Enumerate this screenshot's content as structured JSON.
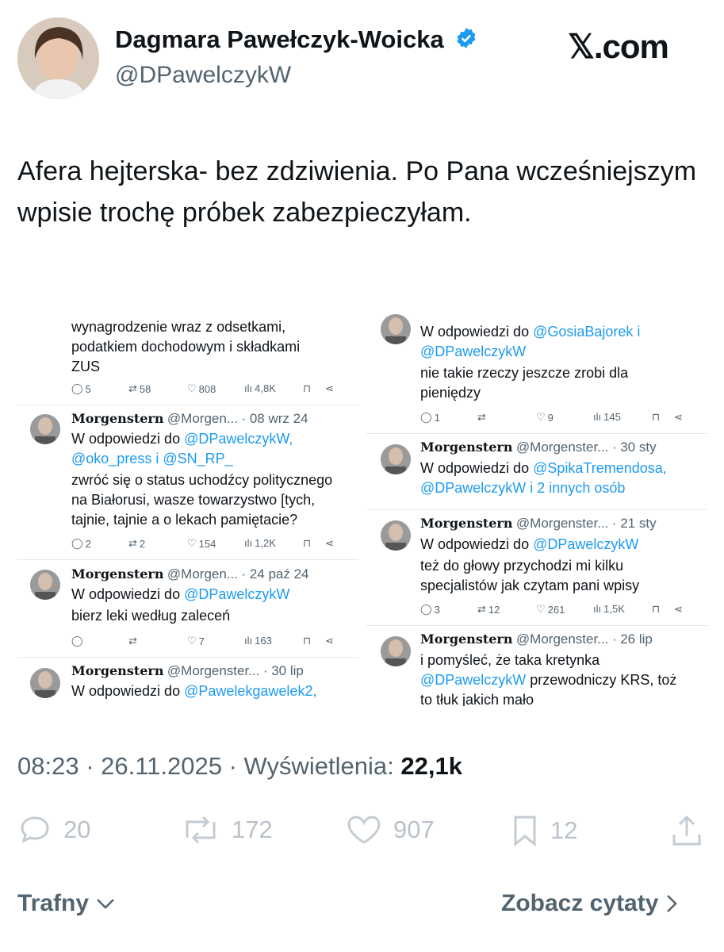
{
  "author": {
    "name": "Dagmara Pawełczyk-Woicka",
    "handle": "@DPawelczykW"
  },
  "brand": "𝕏.com",
  "tweet_text": "Afera hejterska- bez zdziwienia. Po Pana wcześniejszym wpisie trochę próbek zabezpieczyłam.",
  "screenshot": {
    "left_column": [
      {
        "lines": [
          "wynagrodzenie wraz z odsetkami,",
          "podatkiem dochodowym i składkami",
          "ZUS"
        ],
        "stats": {
          "replies": "5",
          "reposts": "58",
          "likes": "808",
          "views": "4,8K"
        }
      },
      {
        "author": "Morgenstern",
        "handle": "@Morgen...",
        "date": "· 08 wrz 24",
        "reply_prefix": "W odpowiedzi do",
        "reply_to_1": "@DPawelczykW,",
        "reply_to_2": "@oko_press i @SN_RP_",
        "lines": [
          "zwróć się o status uchodźcy politycznego",
          "na Białorusi, wasze towarzystwo [tych,",
          "tajnie, tajnie a o lekach pamiętacie?"
        ],
        "stats": {
          "replies": "2",
          "reposts": "2",
          "likes": "154",
          "views": "1,2K"
        }
      },
      {
        "author": "Morgenstern",
        "handle": "@Morgen...",
        "date": "· 24 paź 24",
        "reply_prefix": "W odpowiedzi do",
        "reply_to_1": "@DPawelczykW",
        "lines": [
          "bierz leki według zaleceń"
        ],
        "stats": {
          "replies": "",
          "reposts": "",
          "likes": "7",
          "views": "163"
        }
      },
      {
        "author": "Morgenstern",
        "handle": "@Morgenster...",
        "date": "· 30 lip",
        "reply_prefix": "W odpowiedzi do",
        "reply_to_1": "@Pawelekgawelek2,"
      }
    ],
    "right_column": [
      {
        "reply_prefix": "W odpowiedzi do",
        "reply_to_1": "@GosiaBajorek i",
        "reply_to_2": "@DPawelczykW",
        "lines": [
          "nie takie rzeczy jeszcze zrobi dla",
          "pieniędzy"
        ],
        "stats": {
          "replies": "1",
          "reposts": "",
          "likes": "9",
          "views": "145"
        }
      },
      {
        "author": "Morgenstern",
        "handle": "@Morgenster...",
        "date": "· 30 sty",
        "reply_prefix": "W odpowiedzi do",
        "reply_to_1": "@SpikaTremendosa,",
        "reply_to_2": "@DPawelczykW i 2 innych osób"
      },
      {
        "author": "Morgenstern",
        "handle": "@Morgenster...",
        "date": "· 21 sty",
        "reply_prefix": "W odpowiedzi do",
        "reply_to_1": "@DPawelczykW",
        "lines": [
          "też do głowy przychodzi mi kilku",
          "specjalistów jak czytam pani wpisy"
        ],
        "stats": {
          "replies": "3",
          "reposts": "12",
          "likes": "261",
          "views": "1,5K"
        }
      },
      {
        "author": "Morgenstern",
        "handle": "@Morgenster...",
        "date": "· 26 lip",
        "line_1": "i pomyśleć, że taka kretynka",
        "mention": "@DPawelczykW",
        "line_2_rest": " przewodniczy KRS, toż",
        "line_3": "to tłuk jakich mało"
      }
    ]
  },
  "meta": {
    "time": "08:23 · 26.11.2025 · Wyświetlenia: ",
    "views": "22,1k"
  },
  "actions": {
    "replies": "20",
    "reposts": "172",
    "likes": "907",
    "bookmarks": "12"
  },
  "bottom": {
    "sort": "Trafny",
    "quotes": "Zobacz cytaty"
  }
}
